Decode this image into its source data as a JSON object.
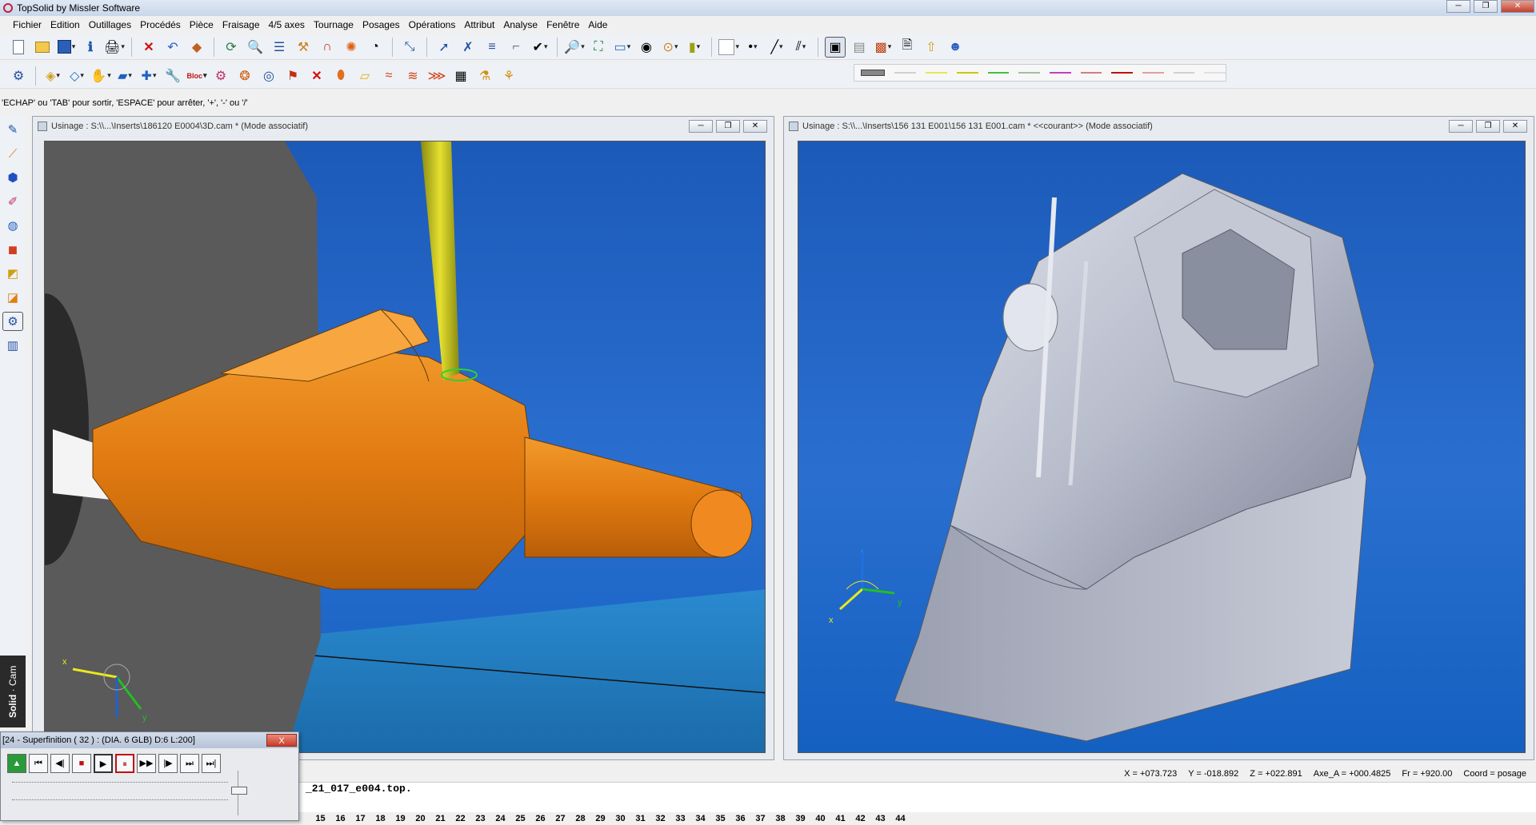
{
  "window": {
    "title": "TopSolid by Missler Software"
  },
  "menu": [
    "Fichier",
    "Edition",
    "Outillages",
    "Procédés",
    "Pièce",
    "Fraisage",
    "4/5 axes",
    "Tournage",
    "Posages",
    "Opérations",
    "Attribut",
    "Analyse",
    "Fenêtre",
    "Aide"
  ],
  "hint": "'ECHAP' ou 'TAB' pour sortir, 'ESPACE' pour arrêter, '+', '-' ou '/'",
  "views": {
    "left": {
      "title": "Usinage : S:\\\\...\\Inserts\\186120 E0004\\3D.cam * (Mode associatif)"
    },
    "right": {
      "title": "Usinage : S:\\\\...\\Inserts\\156 131 E001\\156 131 E001.cam *  <<courant>> (Mode associatif)"
    }
  },
  "triad_labels": {
    "x": "x",
    "y": "y",
    "z": "z"
  },
  "brand": {
    "bold": "Solid",
    "rest": "Cam"
  },
  "status": {
    "x": "X = +073.723",
    "y": "Y = -018.892",
    "z": "Z = +022.891",
    "axe_a": "Axe_A = +000.4825",
    "fr": "Fr = +920.00",
    "coord": "Coord = posage"
  },
  "command_file": "_21_017_e004.top.",
  "frame_numbers": [
    "15",
    "16",
    "17",
    "18",
    "19",
    "20",
    "21",
    "22",
    "23",
    "24",
    "25",
    "26",
    "27",
    "28",
    "29",
    "30",
    "31",
    "32",
    "33",
    "34",
    "35",
    "36",
    "37",
    "38",
    "39",
    "40",
    "41",
    "42",
    "43",
    "44"
  ],
  "simulation": {
    "title": "[24 - Superfinition ( 32 ) :     (DIA. 6 GLB)  D:6  L:200]",
    "close_label": "X"
  },
  "colors": {
    "workpiece_orange": "#e07a10",
    "part_grey": "#b7bccb",
    "background_blue": "#2466c4",
    "tool_yellow": "#c8c40a"
  }
}
